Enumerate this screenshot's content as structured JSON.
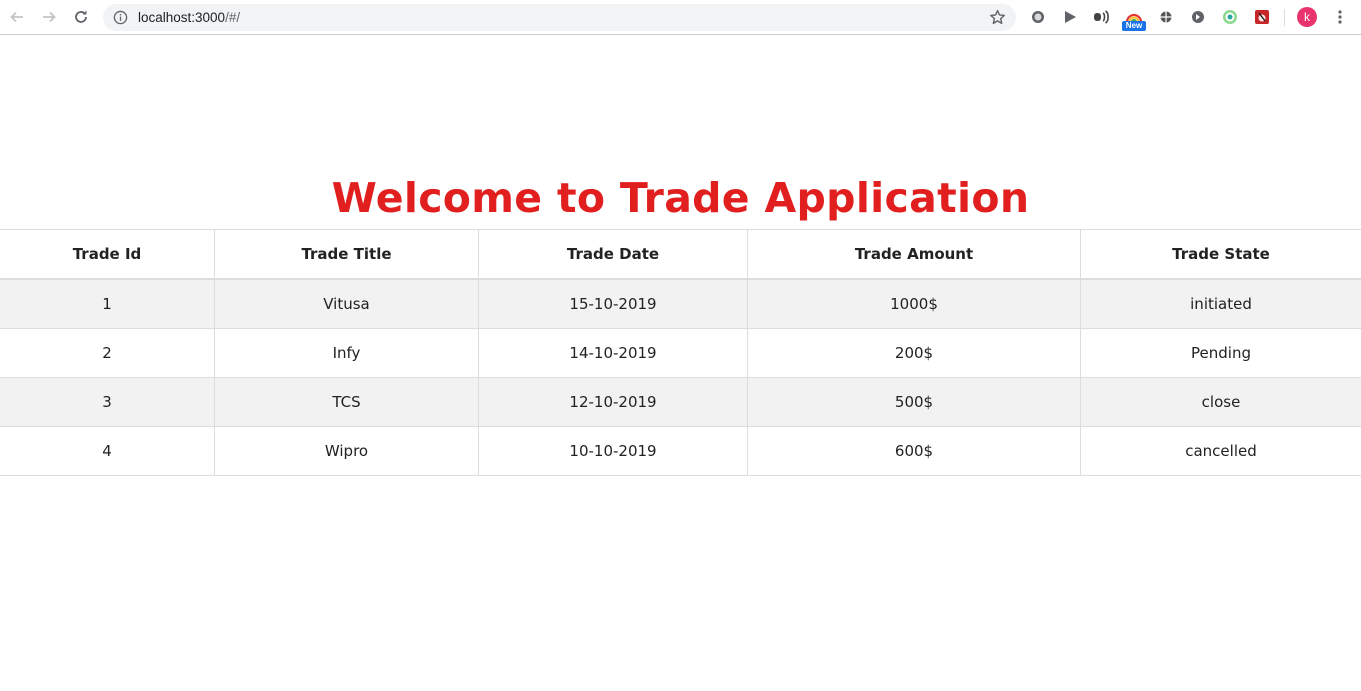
{
  "browser": {
    "url_host": "localhost:3000",
    "url_path": "/#/",
    "new_badge": "New",
    "profile_initial": "k",
    "extensions": [
      "circle-extension-icon",
      "play-extension-icon",
      "cast-extension-icon",
      "new-extension-icon",
      "globe-extension-icon",
      "tag-extension-icon",
      "target-extension-icon",
      "app-extension-icon"
    ]
  },
  "page": {
    "title": "Welcome to Trade Application",
    "title_color": "#e21f1f"
  },
  "table": {
    "headers": [
      "Trade Id",
      "Trade Title",
      "Trade Date",
      "Trade Amount",
      "Trade State"
    ],
    "rows": [
      [
        "1",
        "Vitusa",
        "15-10-2019",
        "1000$",
        "initiated"
      ],
      [
        "2",
        "Infy",
        "14-10-2019",
        "200$",
        "Pending"
      ],
      [
        "3",
        "TCS",
        "12-10-2019",
        "500$",
        "close"
      ],
      [
        "4",
        "Wipro",
        "10-10-2019",
        "600$",
        "cancelled"
      ]
    ]
  }
}
